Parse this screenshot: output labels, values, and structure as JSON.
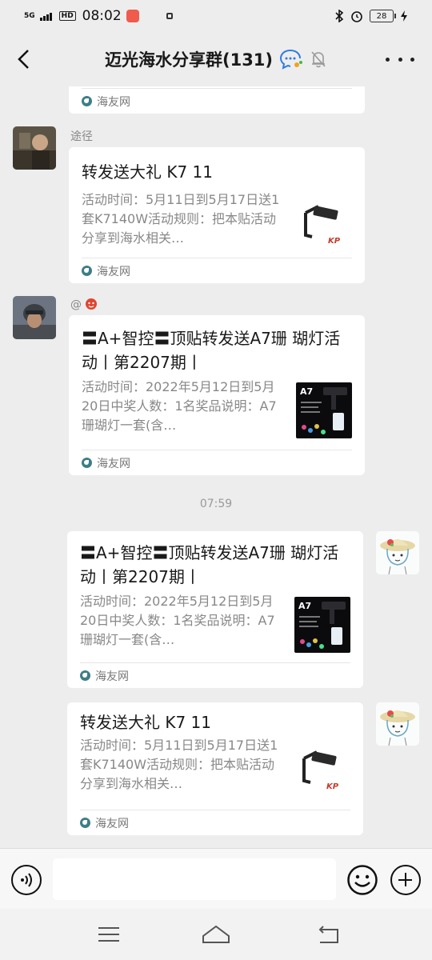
{
  "status_bar": {
    "network": "5G",
    "hd": "HD",
    "time": "08:02",
    "battery": "28"
  },
  "header": {
    "title": "迈光海水分享群(131)"
  },
  "messages": [
    {
      "type": "link_card_partial",
      "site": "海友网"
    },
    {
      "sender": "途径",
      "title": "转发送大礼 K7 11",
      "desc": "活动时间：5月11日到5月17日送1套K7140W活动规则：把本贴活动分享到海水相关…",
      "site": "海友网",
      "thumb": "k7-lamp"
    },
    {
      "sender": "@",
      "title": "〓A+智控〓顶贴转发送A7珊 瑚灯活动丨第2207期丨",
      "desc": "活动时间：2022年5月12日到5月20日中奖人数：1名奖品说明：A7珊瑚灯一套(含…",
      "site": "海友网",
      "thumb": "a7-lamp",
      "thumb_label": "A7"
    },
    {
      "timestamp": "07:59"
    },
    {
      "sender": "self",
      "title": "〓A+智控〓顶贴转发送A7珊 瑚灯活动丨第2207期丨",
      "desc": "活动时间：2022年5月12日到5月20日中奖人数：1名奖品说明：A7珊瑚灯一套(含…",
      "site": "海友网",
      "thumb": "a7-lamp",
      "thumb_label": "A7"
    },
    {
      "sender": "self",
      "title": "转发送大礼 K7 11",
      "desc": "活动时间：5月11日到5月17日送1套K7140W活动规则：把本贴活动分享到海水相关…",
      "site": "海友网",
      "thumb": "k7-lamp"
    }
  ],
  "input": {
    "placeholder": ""
  },
  "colors": {
    "background": "#ededed",
    "card": "#ffffff",
    "muted_text": "#888888",
    "site_icon": "#3d7e86"
  }
}
